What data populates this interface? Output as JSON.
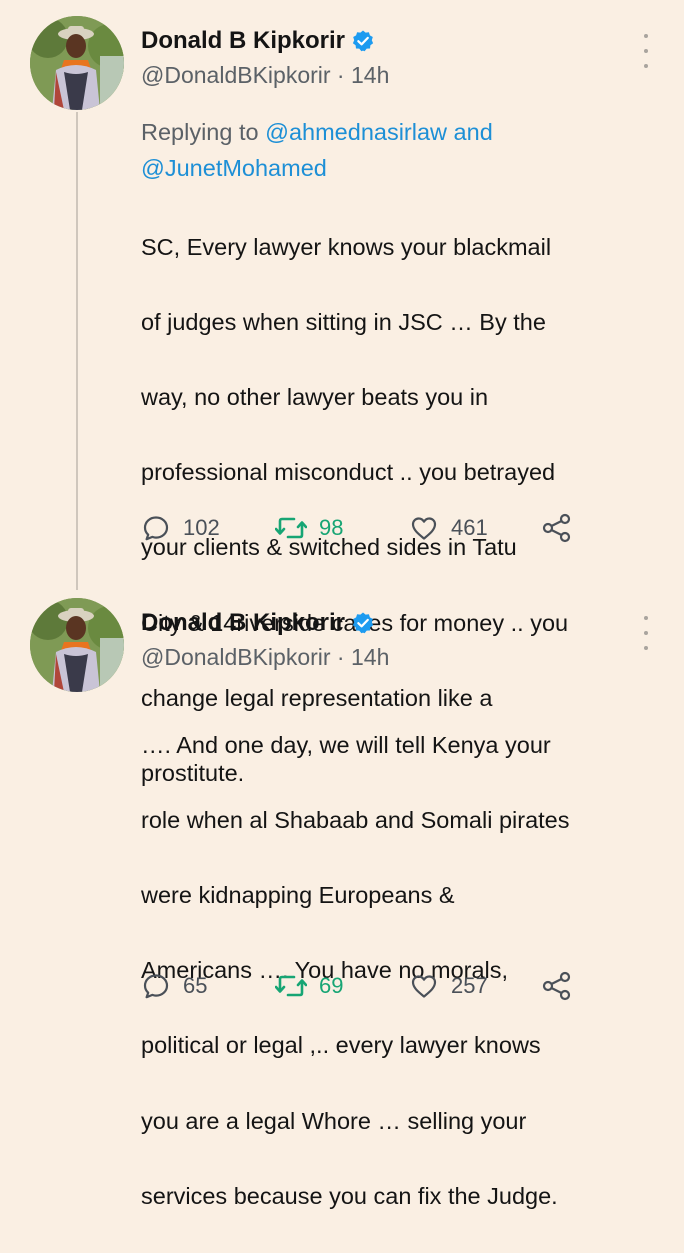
{
  "colors": {
    "background": "#faefe3",
    "mention": "#1d8fd6",
    "retweet_active": "#17a574",
    "verified": "#1d9bf0",
    "secondary_text": "#5b6167"
  },
  "tweets": [
    {
      "author_name": "Donald B Kipkorir",
      "handle": "@DonaldBKipkorir",
      "separator": " · ",
      "time": "14h",
      "reply_prefix": "Replying to ",
      "reply_mention_1": "@ahmednasirlaw",
      "reply_joiner": " and",
      "reply_mention_2": "@JunetMohamed",
      "body_lines": [
        "SC, Every lawyer knows your blackmail",
        "of judges when sitting in JSC … By the",
        "way, no other lawyer beats you in",
        "professional misconduct .. you betrayed",
        "your clients &  switched sides in Tatu",
        "City & 14riverside cases for money .. you",
        "change legal representation like a",
        "prostitute."
      ],
      "replies": "102",
      "retweets": "98",
      "likes": "461",
      "icons": [
        "verified-badge-icon",
        "more-options-icon",
        "reply-icon",
        "retweet-icon",
        "like-icon",
        "share-icon"
      ]
    },
    {
      "author_name": "Donald B Kipkorir",
      "handle": "@DonaldBKipkorir",
      "separator": " · ",
      "time": "14h",
      "body_lines": [
        "…. And one day, we will tell Kenya your",
        "role when al Shabaab and Somali pirates",
        "were kidnapping Europeans &",
        "Americans …. You have no morals,",
        "political or legal  ,.. every lawyer knows",
        "you are a legal Whore … selling your",
        "services because you can fix the Judge."
      ],
      "replies": "65",
      "retweets": "69",
      "likes": "257",
      "icons": [
        "verified-badge-icon",
        "more-options-icon",
        "reply-icon",
        "retweet-icon",
        "like-icon",
        "share-icon"
      ]
    }
  ]
}
